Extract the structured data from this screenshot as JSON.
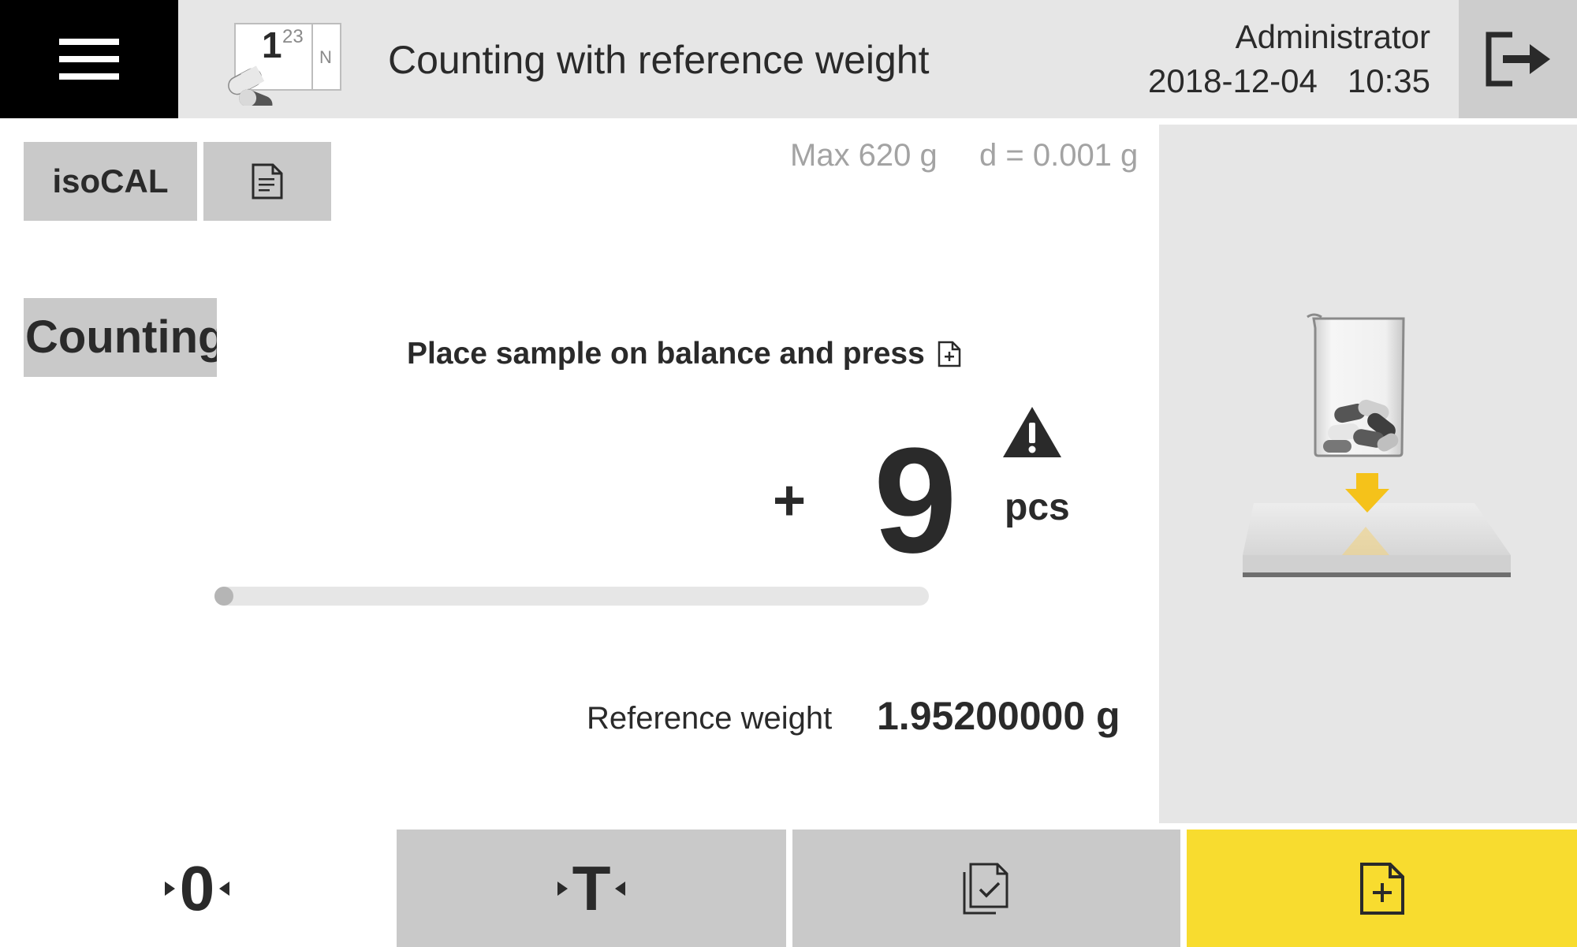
{
  "header": {
    "app_icon_numerals": "1",
    "app_icon_superscript": "23",
    "app_icon_letter": "N",
    "title": "Counting with reference weight",
    "user": "Administrator",
    "date": "2018-12-04",
    "time": "10:35"
  },
  "toolbar_top": {
    "isocal_label": "isoCAL"
  },
  "balance_info": {
    "max": "Max 620 g",
    "readability": "d = 0.001 g"
  },
  "mode": {
    "label": "Counting"
  },
  "instruction": {
    "text": "Place sample on balance and press"
  },
  "result": {
    "sign": "+",
    "value": "9",
    "unit": "pcs",
    "progress_fraction": 0.0
  },
  "reference": {
    "label": "Reference weight",
    "value": "1.95200000 g"
  },
  "bottom_toolbar": {
    "zero_label": "0",
    "tare_label": "T"
  },
  "colors": {
    "accent_yellow": "#f8dc2f",
    "button_gray": "#c9c9c9",
    "panel_gray": "#e6e6e6",
    "menu_black": "#000000",
    "muted_text": "#a3a3a3"
  },
  "icons": {
    "menu": "hamburger-icon",
    "app": "pill-counting-icon",
    "logout": "logout-icon",
    "document": "document-icon",
    "add_document": "add-document-icon",
    "warning": "warning-icon",
    "confirm": "copy-check-icon",
    "illustration": "beaker-on-balance-illustration"
  }
}
